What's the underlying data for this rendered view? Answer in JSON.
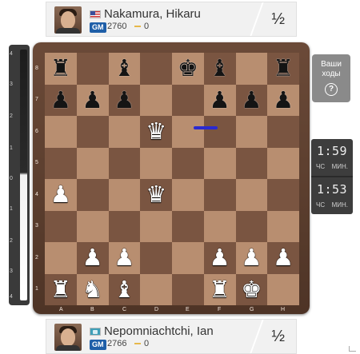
{
  "players": {
    "top": {
      "name": "Nakamura, Hikaru",
      "flag": "us-flag-icon",
      "title": "GM",
      "rating": "2760",
      "delta": "0",
      "score": "½"
    },
    "bottom": {
      "name": "Nepomniachtchi, Ian",
      "flag": "ru-flag-icon",
      "title": "GM",
      "rating": "2766",
      "delta": "0",
      "score": "½"
    }
  },
  "eval_bar": {
    "ticks": [
      "4",
      "3",
      "2",
      "1",
      "0",
      "1",
      "2",
      "3",
      "4"
    ],
    "white_fraction": 0.5
  },
  "board": {
    "ranks": [
      "8",
      "7",
      "6",
      "5",
      "4",
      "3",
      "2",
      "1"
    ],
    "files": [
      "A",
      "B",
      "C",
      "D",
      "E",
      "F",
      "G",
      "H"
    ],
    "position": [
      [
        "bR",
        "",
        "bB",
        "",
        "bK",
        "bB",
        "",
        "bR"
      ],
      [
        "bP",
        "bP",
        "bP",
        "",
        "",
        "bP",
        "bP",
        "bP"
      ],
      [
        "",
        "",
        "",
        "wQ",
        "",
        "",
        "",
        ""
      ],
      [
        "",
        "",
        "",
        "",
        "",
        "",
        "",
        ""
      ],
      [
        "wP",
        "",
        "",
        "wQ",
        "",
        "",
        "",
        ""
      ],
      [
        "",
        "",
        "",
        "",
        "",
        "",
        "",
        ""
      ],
      [
        "",
        "wP",
        "wP",
        "",
        "",
        "wP",
        "wP",
        "wP"
      ],
      [
        "wR",
        "wN",
        "wB",
        "",
        "",
        "wR",
        "wK",
        ""
      ]
    ],
    "arrow": {
      "from": "d6",
      "to": "e6",
      "color": "#2a2ad0"
    }
  },
  "moves_button": {
    "label": "Ваши ходы",
    "icon": "question-circle-icon"
  },
  "clocks": {
    "top": {
      "time": "1:59",
      "units_h": "ЧС",
      "units_m": "МИН."
    },
    "bottom": {
      "time": "1:53",
      "units_h": "ЧС",
      "units_m": "МИН."
    }
  },
  "colors": {
    "light_square": "#b88e70",
    "dark_square": "#7a5541",
    "frame": "#5a3d2e",
    "badge": "#1f5fa8"
  }
}
